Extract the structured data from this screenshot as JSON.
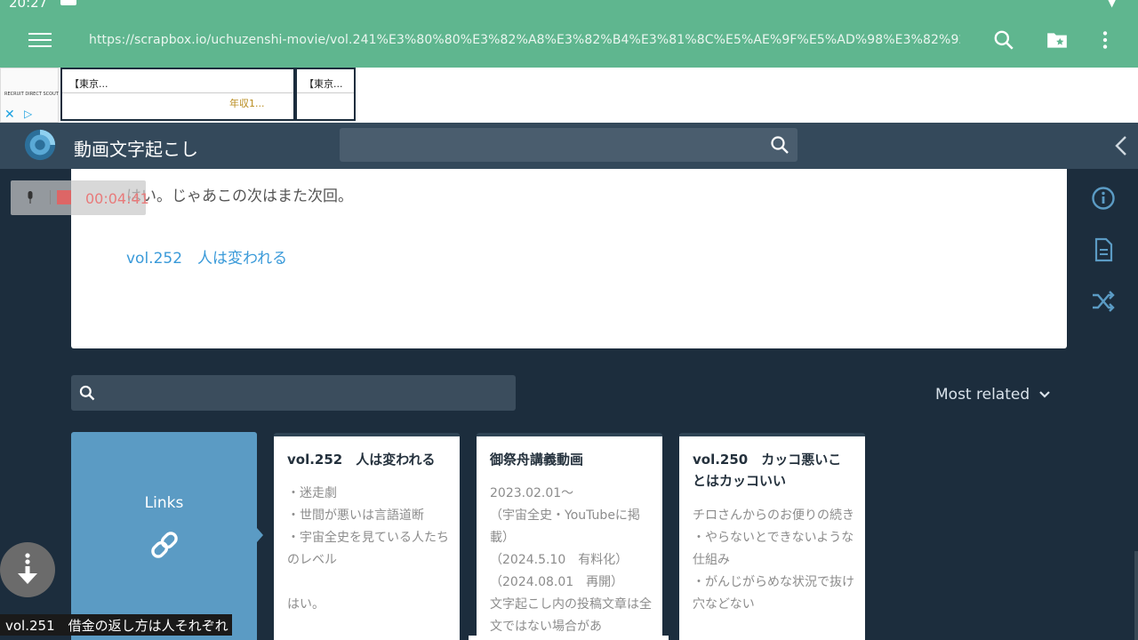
{
  "status": {
    "time": "20:27"
  },
  "browser": {
    "url": "https://scrapbox.io/uchuzenshi-movie/vol.241%E3%80%80%E3%82%A8%E3%82%B4%E3%81%8C%E5%AE%9F%E5%AD%98%E3%82%92%E5%..."
  },
  "ad": {
    "logo_text": "RECRUIT DIRECT SCOUT",
    "card1_title": "【東京...",
    "card1_salary": "年収1...",
    "card2_title": "【東京..."
  },
  "header": {
    "project_title": "動画文字起こし"
  },
  "recorder": {
    "time": "00:04:41"
  },
  "page": {
    "line": "はい。じゃあこの次はまた次回。",
    "link": "vol.252　人は変われる"
  },
  "related": {
    "sort_label": "Most related",
    "links_label": "Links",
    "cards": [
      {
        "title": "vol.252　人は変われる",
        "body": "・迷走劇\n・世間が悪いは言語道断\n・宇宙全史を見ている人たちのレベル\n\nはい。"
      },
      {
        "title": "御祭舟講義動画",
        "body": "2023.02.01～\n（宇宙全史・YouTubeに掲載）\n（2024.5.10　有料化）\n（2024.08.01　再開）\n文字起こし内の投稿文章は全文ではない場合があ"
      },
      {
        "title": "vol.250　カッコ悪いことはカッコいい",
        "body": "チロさんからのお便りの続き\n・やらないとできないような仕組み\n・がんじがらめな状況で抜け穴などない"
      }
    ]
  },
  "tooltip": {
    "text": "vol.251　借金の返し方は人それぞれ"
  },
  "colors": {
    "topbar": "#5fb68f",
    "header": "#34495b",
    "background": "#1c2d3d",
    "link": "#3a9ad9",
    "links_card": "#5b9bc4"
  },
  "icons": [
    "menu-icon",
    "search-icon",
    "bookmark-folder-icon",
    "more-vert-icon",
    "info-icon",
    "page-icon",
    "shuffle-icon",
    "link-icon",
    "scroll-down-icon",
    "chevron-left-icon",
    "chevron-down-icon"
  ]
}
